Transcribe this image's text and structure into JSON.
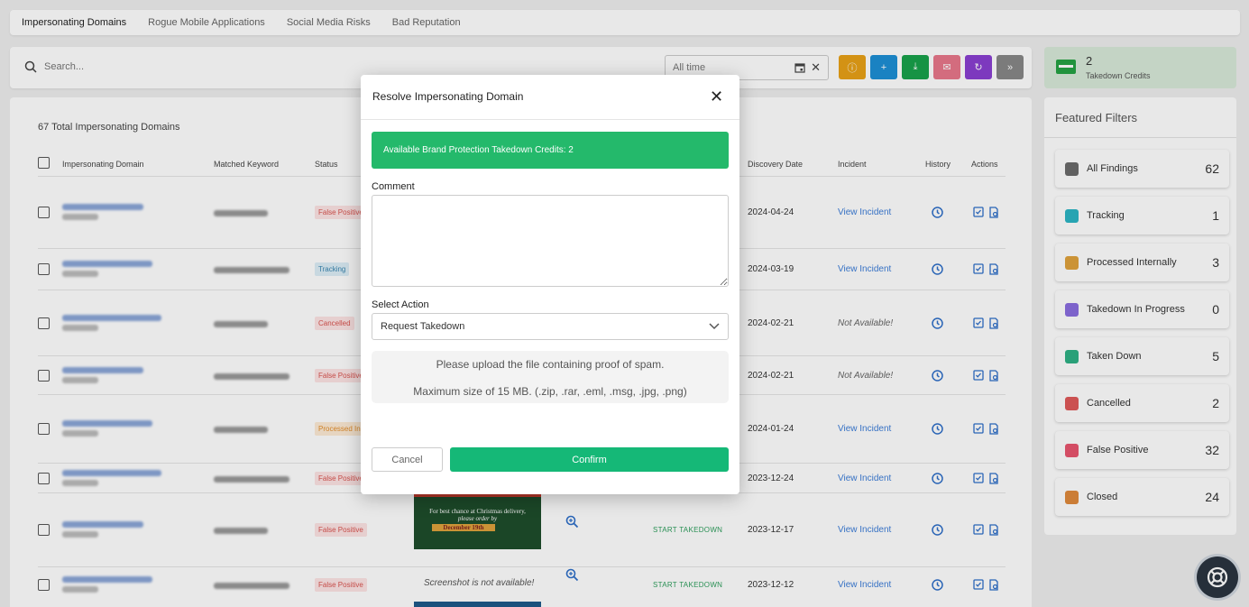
{
  "tabs": [
    "Impersonating Domains",
    "Rogue Mobile Applications",
    "Social Media Risks",
    "Bad Reputation"
  ],
  "search": {
    "placeholder": "Search..."
  },
  "date_filter": {
    "value": "All time"
  },
  "toolbar_buttons": [
    {
      "name": "info-button",
      "color": "#e8a117",
      "glyph": "ⓘ"
    },
    {
      "name": "add-button",
      "color": "#1d8fd6",
      "glyph": "+"
    },
    {
      "name": "download-button",
      "color": "#19a24b",
      "glyph": "⤓"
    },
    {
      "name": "feedback-button",
      "color": "#e8778b",
      "glyph": "✉"
    },
    {
      "name": "refresh-button",
      "color": "#8a3fd1",
      "glyph": "↻"
    },
    {
      "name": "more-button",
      "color": "#888888",
      "glyph": "»"
    }
  ],
  "credits": {
    "count": "2",
    "label": "Takedown Credits"
  },
  "main": {
    "total": "67 Total Impersonating Domains",
    "columns": [
      "Impersonating Domain",
      "Matched Keyword",
      "Status",
      "Discovery Date",
      "Incident",
      "History",
      "Actions"
    ]
  },
  "rows": [
    {
      "status": "False Positive",
      "status_class": "st-fp",
      "date": "2024-04-24",
      "incident": "View Incident",
      "extra": ""
    },
    {
      "status": "Tracking",
      "status_class": "st-tr",
      "date": "2024-03-19",
      "incident": "View Incident",
      "extra": ""
    },
    {
      "status": "Cancelled",
      "status_class": "st-ca",
      "date": "2024-02-21",
      "incident": "Not Available!",
      "extra": ""
    },
    {
      "status": "False Positive",
      "status_class": "st-fp",
      "date": "2024-02-21",
      "incident": "Not Available!",
      "extra": ""
    },
    {
      "status": "Processed In",
      "status_class": "st-pi",
      "date": "2024-01-24",
      "incident": "View Incident",
      "extra": ""
    },
    {
      "status": "False Positive",
      "status_class": "st-fp",
      "date": "2023-12-24",
      "incident": "View Incident",
      "extra": ""
    },
    {
      "status": "False Positive",
      "status_class": "st-fp",
      "date": "2023-12-17",
      "incident": "View Incident",
      "extra": "START TAKEDOWN"
    },
    {
      "status": "False Positive",
      "status_class": "st-fp",
      "date": "2023-12-12",
      "incident": "View Incident",
      "extra": "START TAKEDOWN"
    }
  ],
  "screenshot_text": {
    "missing": "Screenshot is not available!",
    "ad_line1": "For best chance at Christmas delivery,",
    "ad_line2": "please order by",
    "ad_line3": "December 19th"
  },
  "featured_filters": {
    "title": "Featured Filters",
    "items": [
      {
        "label": "All Findings",
        "count": "62",
        "color": "#6b6b6b"
      },
      {
        "label": "Tracking",
        "count": "1",
        "color": "#2bb5c4"
      },
      {
        "label": "Processed Internally",
        "count": "3",
        "color": "#e0a23c"
      },
      {
        "label": "Takedown In Progress",
        "count": "0",
        "color": "#8a6de0"
      },
      {
        "label": "Taken Down",
        "count": "5",
        "color": "#2fb084"
      },
      {
        "label": "Cancelled",
        "count": "2",
        "color": "#e05a5a"
      },
      {
        "label": "False Positive",
        "count": "32",
        "color": "#e8556e"
      },
      {
        "label": "Closed",
        "count": "24",
        "color": "#e08a3c"
      }
    ]
  },
  "modal": {
    "title": "Resolve Impersonating Domain",
    "banner": "Available Brand Protection Takedown Credits: 2",
    "comment_label": "Comment",
    "comment_value": "",
    "action_label": "Select Action",
    "action_value": "Request Takedown",
    "upload_line1": "Please upload the file containing proof of spam.",
    "upload_line2": "Maximum size of 15 MB. (.zip, .rar, .eml, .msg, .jpg, .png)",
    "cancel": "Cancel",
    "confirm": "Confirm"
  }
}
